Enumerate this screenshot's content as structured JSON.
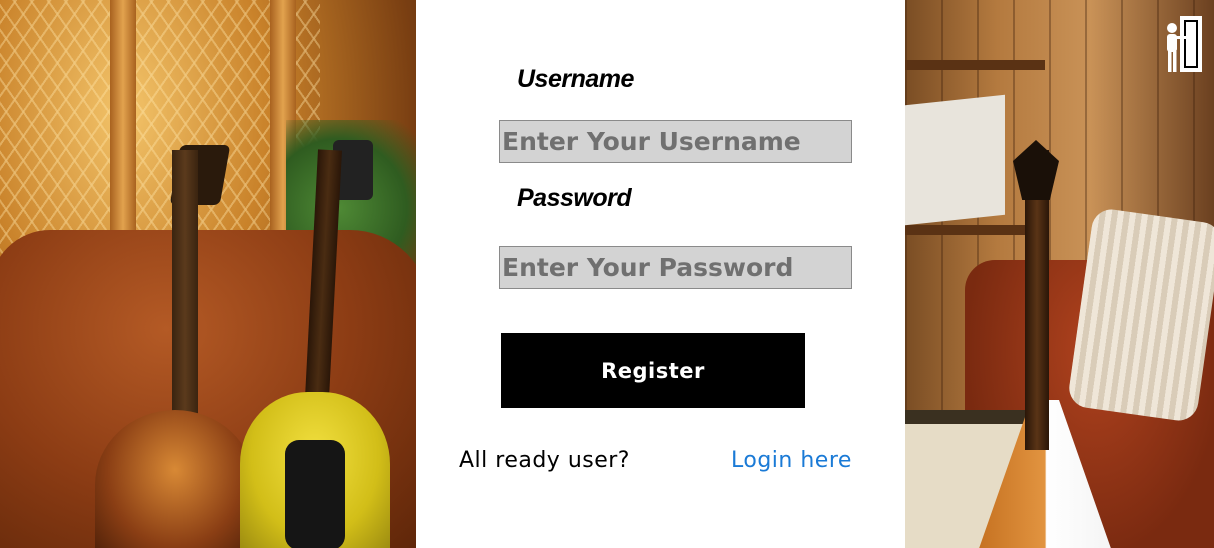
{
  "form": {
    "username_label": "Username",
    "username_placeholder": "Enter Your Username",
    "username_value": "",
    "password_label": "Password",
    "password_placeholder": "Enter Your Password",
    "password_value": "",
    "register_label": "Register"
  },
  "footer": {
    "prompt": "All ready user?",
    "login_link": "Login here"
  },
  "icons": {
    "top_right": "door-exit-icon"
  },
  "colors": {
    "link": "#1a7ad6",
    "button_bg": "#000000",
    "input_bg": "#d3d3d3"
  }
}
